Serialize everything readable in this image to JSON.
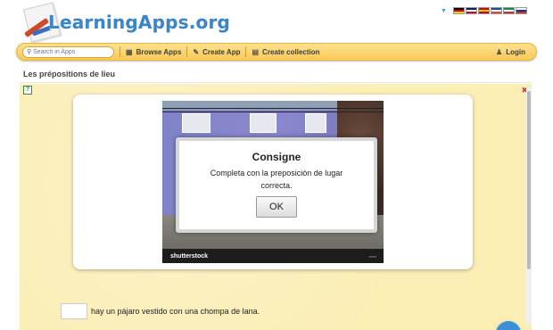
{
  "header": {
    "logo_text": "LearningApps.org",
    "languages": [
      {
        "name": "flag-de-icon",
        "colors": [
          "#000000",
          "#dd0000",
          "#ffce00"
        ]
      },
      {
        "name": "flag-uk-icon",
        "colors": [
          "#012169",
          "#ffffff",
          "#c8102e"
        ]
      },
      {
        "name": "flag-es-icon",
        "colors": [
          "#c60b1e",
          "#ffc400",
          "#c60b1e"
        ]
      },
      {
        "name": "flag-fr-icon",
        "colors": [
          "#0055a4",
          "#ffffff",
          "#ef4135"
        ]
      },
      {
        "name": "flag-it-icon",
        "colors": [
          "#009246",
          "#ffffff",
          "#ce2b37"
        ]
      },
      {
        "name": "flag-ru-icon",
        "colors": [
          "#ffffff",
          "#0039a6",
          "#d52b1e"
        ]
      }
    ]
  },
  "nav": {
    "search_placeholder": "Search in Apps",
    "browse": "Browse Apps",
    "create_app": "Create App",
    "create_collection": "Create collection",
    "login": "Login"
  },
  "page": {
    "title": "Les prépositions de lieu"
  },
  "photo": {
    "watermark": "shutterstock"
  },
  "dialog": {
    "title": "Consigne",
    "text": "Completa con la preposición de lugar correcta.",
    "ok": "OK"
  },
  "question": {
    "text": "hay un pájaro vestido con una chompa de lana."
  },
  "colors": {
    "navbar": "#f9ca56",
    "app_background": "#fbeeb5",
    "logo": "#3a86c8",
    "fab": "#3b8fd8"
  }
}
